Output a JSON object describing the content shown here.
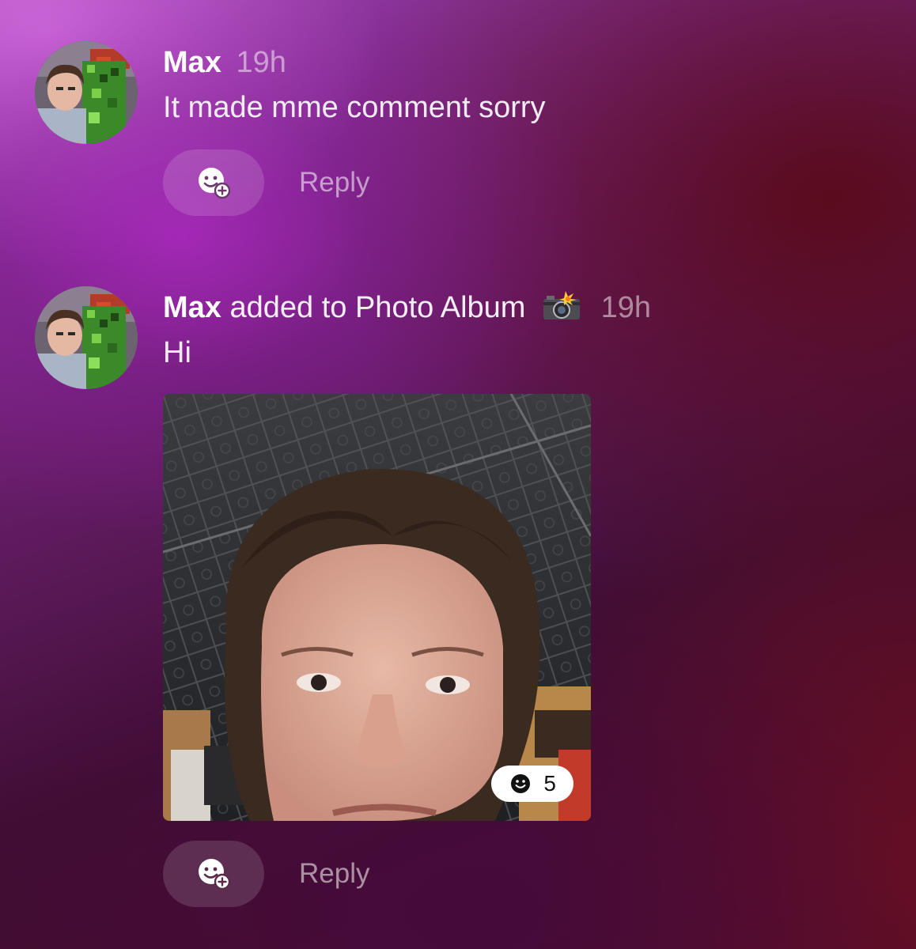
{
  "posts": [
    {
      "author": "Max",
      "action": "",
      "album_emoji": "",
      "time": "19h",
      "text": "It made mme comment sorry",
      "reply_label": "Reply",
      "react_icon": "add-reaction-icon",
      "avatar_icon": "profile-avatar"
    },
    {
      "author": "Max",
      "action": "added to Photo Album",
      "album_emoji": "camera-flash-emoji",
      "time": "19h",
      "text": "Hi",
      "reply_label": "Reply",
      "react_icon": "add-reaction-icon",
      "avatar_icon": "profile-avatar",
      "photo": {
        "description_icon": "selfie-photo",
        "reaction_count": "5",
        "reaction_icon": "smiley-icon"
      }
    }
  ],
  "colors": {
    "author": "#ffffff",
    "time": "#ffffff80",
    "reply": "#ffffff8c",
    "badge_bg": "#ffffff"
  }
}
